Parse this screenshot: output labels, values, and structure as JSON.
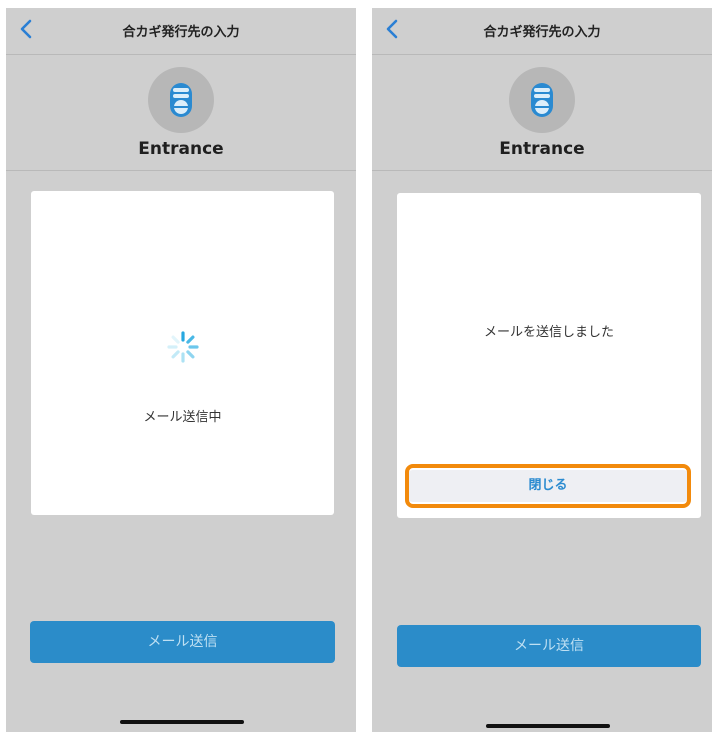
{
  "screens": [
    {
      "nav_title": "合カギ発行先の入力",
      "device_name": "Entrance",
      "status": "メール送信中",
      "send_button": "メール送信"
    },
    {
      "nav_title": "合カギ発行先の入力",
      "device_name": "Entrance",
      "status": "メールを送信しました",
      "close_button": "閉じる",
      "send_button": "メール送信"
    }
  ],
  "colors": {
    "accent": "#2b8bd0",
    "send_button_bg": "#2b8cc9",
    "highlight": "#f28a0c",
    "background": "#cfcfcf"
  },
  "icons": [
    "back-chevron-icon",
    "smart-lock-icon",
    "loading-spinner-icon"
  ]
}
